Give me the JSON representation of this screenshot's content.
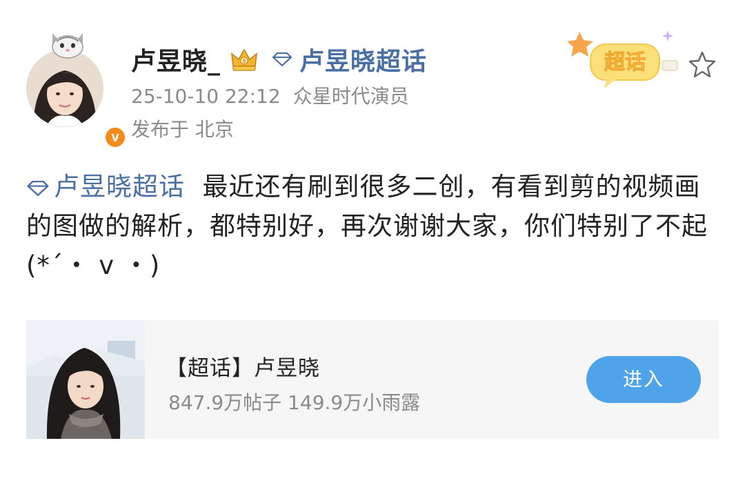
{
  "post": {
    "username": "卢昱晓_",
    "verified_badge": "v",
    "topic_link": "卢昱晓超话",
    "timestamp": "25-10-10 22:12",
    "source": "众星时代演员",
    "location": "发布于 北京",
    "super_topic_badge": "超话",
    "content": {
      "topic": "卢昱晓超话",
      "text": "最近还有刷到很多二创，有看到剪的视频画的图做的解析，都特别好，再次谢谢大家，你们特别了不起 (*´・ v ・)"
    }
  },
  "card": {
    "title": "【超话】卢昱晓",
    "stats": "847.9万帖子 149.9万小雨露",
    "enter_label": "进入"
  },
  "icons": [
    "crown-icon",
    "diamond-icon",
    "star-icon",
    "pet-hat-icon"
  ],
  "colors": {
    "link": "#4a6fa5",
    "button": "#4fa3e8",
    "badge": "#f58a1f",
    "meta": "#8a8a8a"
  }
}
